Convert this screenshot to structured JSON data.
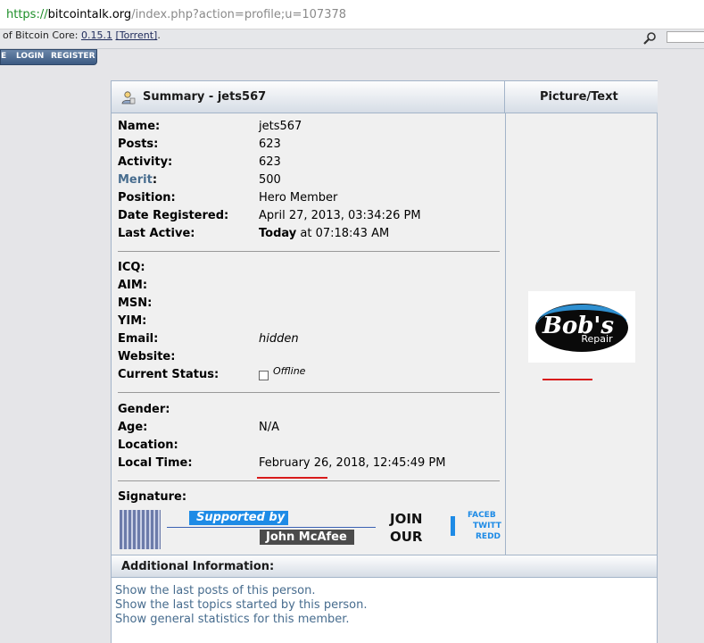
{
  "browser": {
    "url_scheme": "https://",
    "url_host": "bitcointalk.org",
    "url_path": "/index.php?action=profile;u=107378"
  },
  "header": {
    "notice_prefix": "of Bitcoin Core: ",
    "notice_version": "0.15.1",
    "notice_torrent": "[Torrent]",
    "notice_suffix": "."
  },
  "menu": {
    "item_e": "E",
    "login": "LOGIN",
    "register": "REGISTER"
  },
  "summary": {
    "title": "Summary - jets567",
    "picture_title": "Picture/Text"
  },
  "fields": [
    {
      "label": "Name:",
      "value": "jets567"
    },
    {
      "label": "Posts:",
      "value": "623"
    },
    {
      "label": "Activity:",
      "value": "623"
    },
    {
      "label": "Merit",
      "label_suffix": ":",
      "value": "500"
    },
    {
      "label": "Position:",
      "value": "Hero Member"
    },
    {
      "label": "Date Registered:",
      "value": "April 27, 2013, 03:34:26 PM"
    },
    {
      "label": "Last Active:",
      "value_bold": "Today",
      "value": " at 07:18:43 AM"
    }
  ],
  "contact": [
    {
      "label": "ICQ:",
      "value": ""
    },
    {
      "label": "AIM:",
      "value": ""
    },
    {
      "label": "MSN:",
      "value": ""
    },
    {
      "label": "YIM:",
      "value": ""
    },
    {
      "label": "Email:",
      "value": "hidden"
    },
    {
      "label": "Website:",
      "value": ""
    },
    {
      "label": "Current Status:",
      "value": "Offline"
    }
  ],
  "personal": [
    {
      "label": "Gender:",
      "value": ""
    },
    {
      "label": "Age:",
      "value": "N/A"
    },
    {
      "label": "Location:",
      "value": ""
    },
    {
      "label": "Local Time:",
      "value": "February 26, 2018, 12:45:49 PM"
    }
  ],
  "signature": {
    "label": "Signature:",
    "supported_by": "Supported by",
    "name": "John McAfee",
    "join_line1": "JOIN",
    "join_line2": "OUR",
    "social_1": "FACEB",
    "social_2": "TWITT",
    "social_3": "REDD"
  },
  "avatar": {
    "text_main": "Bob's",
    "text_sub": "Repair"
  },
  "additional": {
    "title": "Additional Information:",
    "links": [
      "Show the last posts of this person.",
      "Show the last topics started by this person.",
      "Show general statistics for this member."
    ]
  },
  "colors": {
    "link": "#476c8e",
    "annotation_red": "#d81b1b",
    "accent_blue": "#1e8be6"
  }
}
